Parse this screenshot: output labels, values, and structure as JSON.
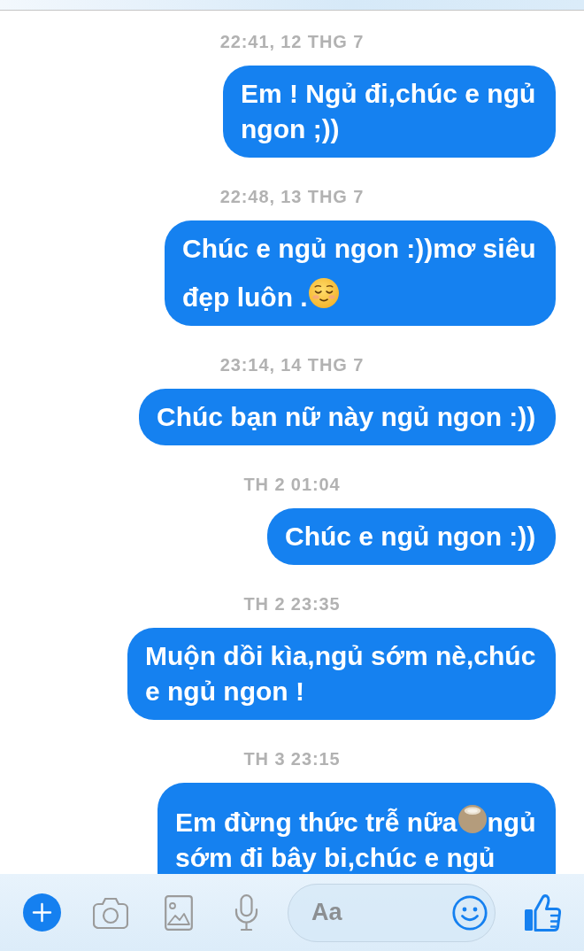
{
  "messages": [
    {
      "timestamp": "22:41, 12 THG 7",
      "parts": [
        {
          "kind": "text",
          "text": "Em ! Ngủ đi,chúc e ngủ ngon ;))"
        }
      ]
    },
    {
      "timestamp": "22:48, 13 THG 7",
      "parts": [
        {
          "kind": "text",
          "text": "Chúc e ngủ ngon :))mơ siêu đẹp luôn ."
        },
        {
          "kind": "emoji"
        }
      ]
    },
    {
      "timestamp": "23:14, 14 THG 7",
      "parts": [
        {
          "kind": "text",
          "text": "Chúc bạn nữ này ngủ ngon :))"
        }
      ]
    },
    {
      "timestamp": "TH 2 01:04",
      "parts": [
        {
          "kind": "text",
          "text": "Chúc e ngủ ngon :))"
        }
      ]
    },
    {
      "timestamp": "TH 2 23:35",
      "parts": [
        {
          "kind": "text",
          "text": "Muộn dồi kìa,ngủ sớm nè,chúc e ngủ ngon !"
        }
      ]
    },
    {
      "timestamp": "TH 3 23:15",
      "parts": [
        {
          "kind": "text",
          "text": "Em đừng thức trễ nữa"
        },
        {
          "kind": "smudge"
        },
        {
          "kind": "text",
          "text": "ngủ sớm đi bây bi,chúc e ngủ"
        }
      ]
    }
  ],
  "composer": {
    "placeholder": "Aa"
  }
}
